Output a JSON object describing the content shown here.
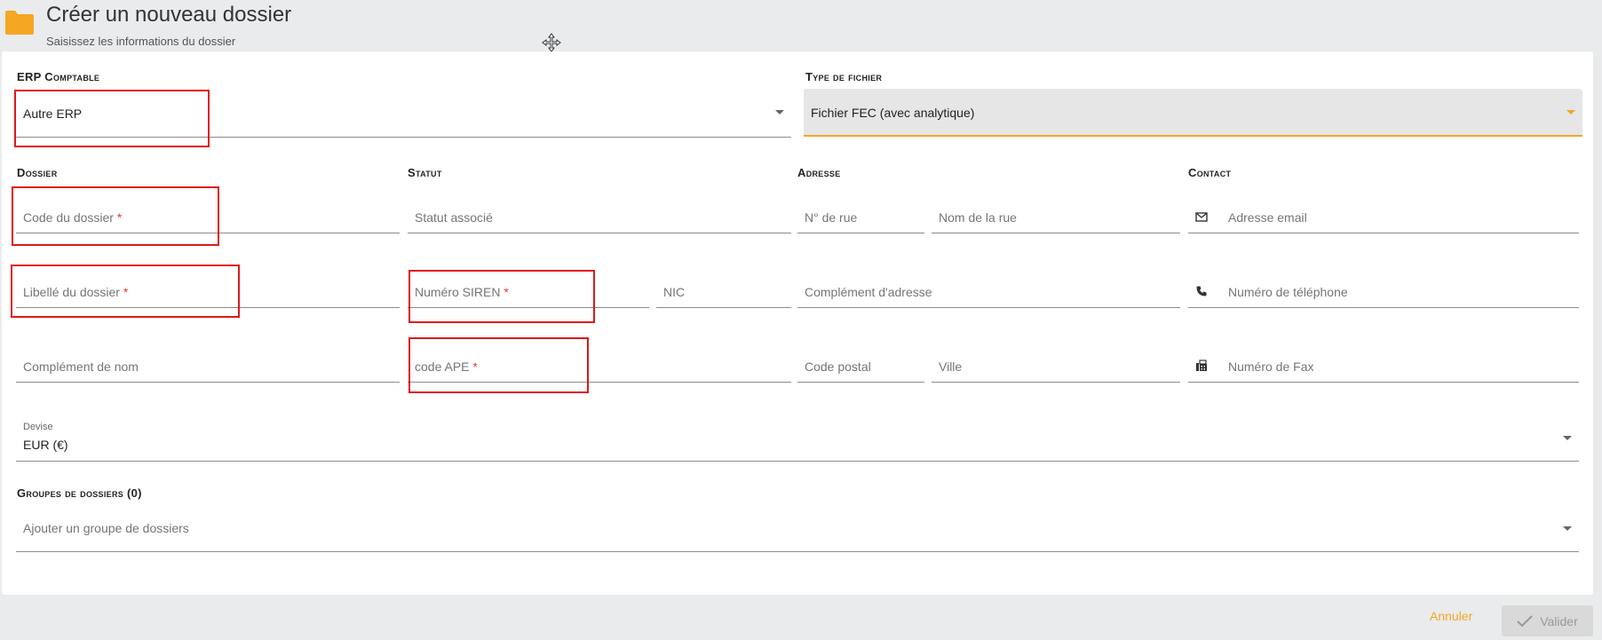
{
  "header": {
    "title": "Créer un nouveau dossier",
    "subtitle": "Saisissez les informations du dossier"
  },
  "erp": {
    "section_label": "ERP Comptable",
    "value": "Autre ERP"
  },
  "file_type": {
    "section_label": "Type de fichier",
    "value": "Fichier FEC (avec analytique)"
  },
  "dossier": {
    "section_label": "Dossier",
    "code_placeholder": "Code du dossier",
    "libelle_placeholder": "Libellé du dossier",
    "complement_nom_placeholder": "Complément de nom"
  },
  "statut": {
    "section_label": "Statut",
    "statut_placeholder": "Statut associé",
    "siren_placeholder": "Numéro SIREN",
    "nic_placeholder": "NIC",
    "ape_placeholder": "code APE"
  },
  "adresse": {
    "section_label": "Adresse",
    "rue_num_placeholder": "N° de rue",
    "rue_nom_placeholder": "Nom de la rue",
    "complement_placeholder": "Complément d'adresse",
    "cp_placeholder": "Code postal",
    "ville_placeholder": "Ville"
  },
  "contact": {
    "section_label": "Contact",
    "email_placeholder": "Adresse email",
    "phone_placeholder": "Numéro de téléphone",
    "fax_placeholder": "Numéro de Fax"
  },
  "devise": {
    "label": "Devise",
    "value": "EUR (€)"
  },
  "groupes": {
    "section_label": "Groupes de dossiers (0)",
    "placeholder": "Ajouter un groupe de dossiers"
  },
  "required_marker": "*",
  "footer": {
    "cancel_label": "Annuler",
    "submit_label": "Valider"
  },
  "colors": {
    "accent": "#f5a623",
    "annotation_red": "#e01818",
    "required": "#e53935"
  }
}
